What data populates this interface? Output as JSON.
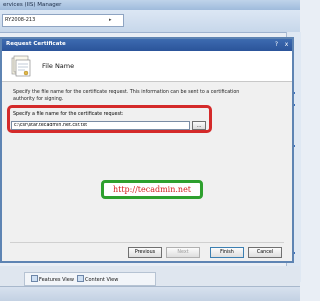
{
  "background_window": {
    "title": "ervices (IIS) Manager",
    "address": "RY2008-213",
    "address_arrow": "▸",
    "tabs": [
      {
        "label": "Features View"
      },
      {
        "label": "Content View"
      }
    ]
  },
  "dialog": {
    "title": "Request Certificate",
    "help_glyph": "?",
    "close_glyph": "x",
    "icon": "certificate-wizard-icon",
    "heading": "File Name",
    "description": "Specify the file name for the certificate request. This information can be sent to a certification authority for signing.",
    "file_field": {
      "label": "Specify a file name for the certificate request:",
      "value": "c:\\csr\\star.tecadmin.net.csr.txt"
    },
    "browse_label": "...",
    "watermark": "http://tecadmin.net",
    "buttons": {
      "previous": "Previous",
      "next": "Next",
      "finish": "Finish",
      "cancel": "Cancel"
    }
  },
  "colors": {
    "dialog_titlebar": "#2b549a",
    "highlight_border": "#d42a2a",
    "watermark_border": "#2ea02e",
    "watermark_text": "#d32020"
  }
}
